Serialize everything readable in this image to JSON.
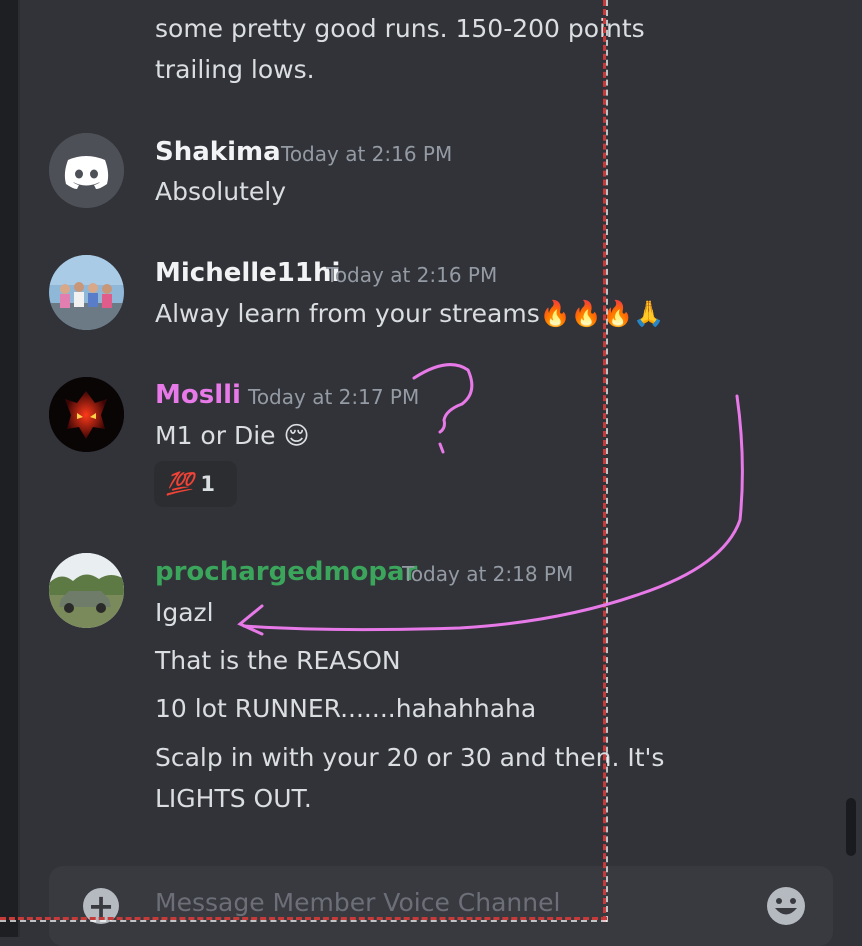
{
  "prev_message": {
    "line1": "some pretty good runs. 150-200 points",
    "line2": "trailing lows."
  },
  "messages": [
    {
      "username": "Shakima",
      "username_color": "#f2f3f5",
      "timestamp": "Today at 2:16 PM",
      "lines": [
        "Absolutely"
      ],
      "avatar": "discord-logo-avatar"
    },
    {
      "username": "Michelle11hi",
      "username_color": "#f2f3f5",
      "timestamp": "Today at 2:16 PM",
      "lines": [
        "Alway learn from your streams🔥🔥🔥🙏"
      ],
      "avatar": "group-photo-avatar"
    },
    {
      "username": "Moslli",
      "username_color": "#e879e8",
      "timestamp": "Today at 2:17 PM",
      "lines": [
        "M1 or Die 😌"
      ],
      "avatar": "demon-face-avatar",
      "reaction": {
        "emoji": "💯",
        "count": "1"
      }
    },
    {
      "username": "prochargedmopar",
      "username_color": "#3ba55c",
      "timestamp": "Today at 2:18 PM",
      "lines": [
        "Igazl",
        "That is the REASON",
        "10 lot RUNNER.......hahahhaha",
        "Scalp in with your 20 or 30 and then.    It's",
        "LIGHTS OUT."
      ],
      "avatar": "car-photo-avatar"
    }
  ],
  "composer": {
    "placeholder": "Message Member Voice Channel",
    "add_icon": "plus-circle-icon",
    "emoji_icon": "smile-icon"
  },
  "colors": {
    "background": "#313338",
    "annotation_pink": "#e879e8",
    "annotation_dashed": "#c73a3a"
  }
}
